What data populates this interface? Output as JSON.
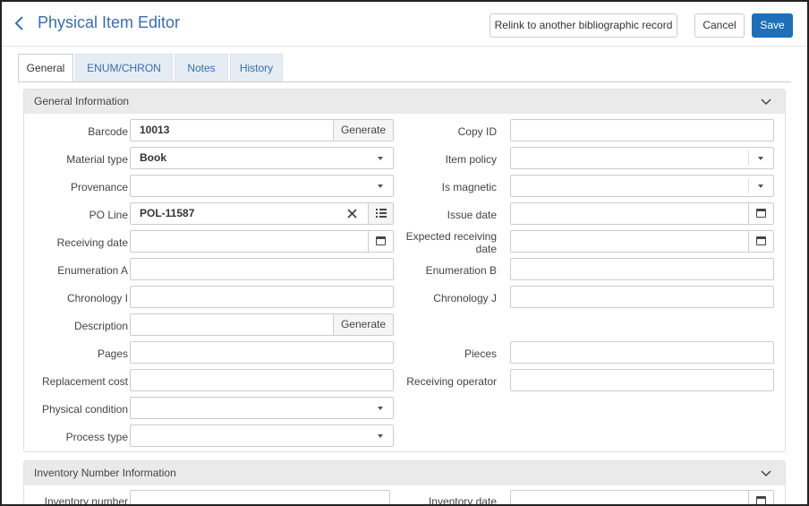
{
  "header": {
    "title": "Physical Item Editor",
    "relink_label": "Relink to another bibliographic record",
    "cancel_label": "Cancel",
    "save_label": "Save"
  },
  "tabs": [
    {
      "label": "General",
      "active": true
    },
    {
      "label": "ENUM/CHRON",
      "active": false
    },
    {
      "label": "Notes",
      "active": false
    },
    {
      "label": "History",
      "active": false
    }
  ],
  "general_section": {
    "title": "General Information",
    "fields": {
      "barcode": {
        "label": "Barcode",
        "value": "10013",
        "button": "Generate"
      },
      "copy_id": {
        "label": "Copy ID",
        "value": ""
      },
      "material_type": {
        "label": "Material type",
        "value": "Book"
      },
      "item_policy": {
        "label": "Item policy",
        "value": ""
      },
      "provenance": {
        "label": "Provenance",
        "value": ""
      },
      "is_magnetic": {
        "label": "Is magnetic",
        "value": ""
      },
      "po_line": {
        "label": "PO Line",
        "value": "POL-11587"
      },
      "issue_date": {
        "label": "Issue date",
        "value": ""
      },
      "receiving_date": {
        "label": "Receiving date",
        "value": ""
      },
      "expected_receiving_date": {
        "label": "Expected receiving date",
        "label_line1": "Expected receiving",
        "label_line2": "date",
        "value": ""
      },
      "enumeration_a": {
        "label": "Enumeration A",
        "value": ""
      },
      "enumeration_b": {
        "label": "Enumeration B",
        "value": ""
      },
      "chronology_i": {
        "label": "Chronology I",
        "value": ""
      },
      "chronology_j": {
        "label": "Chronology J",
        "value": ""
      },
      "description": {
        "label": "Description",
        "value": "",
        "button": "Generate"
      },
      "pages": {
        "label": "Pages",
        "value": ""
      },
      "pieces": {
        "label": "Pieces",
        "value": ""
      },
      "replacement_cost": {
        "label": "Replacement cost",
        "value": ""
      },
      "receiving_operator": {
        "label": "Receiving operator",
        "value": ""
      },
      "physical_condition": {
        "label": "Physical condition",
        "value": ""
      },
      "process_type": {
        "label": "Process type",
        "value": ""
      }
    }
  },
  "inventory_section": {
    "title": "Inventory Number Information",
    "fields": {
      "inventory_number": {
        "label": "Inventory number",
        "value": ""
      },
      "inventory_date": {
        "label": "Inventory date",
        "value": ""
      }
    }
  },
  "icons": {
    "back": "chevron-left-icon",
    "collapse": "chevron-down-icon",
    "clear": "close-icon",
    "list": "list-icon",
    "calendar": "calendar-icon",
    "dropdown": "caret-down-icon"
  },
  "colors": {
    "accent": "#1e6fb8",
    "title": "#3a6ea8",
    "section_header_bg": "#eaeaea"
  }
}
